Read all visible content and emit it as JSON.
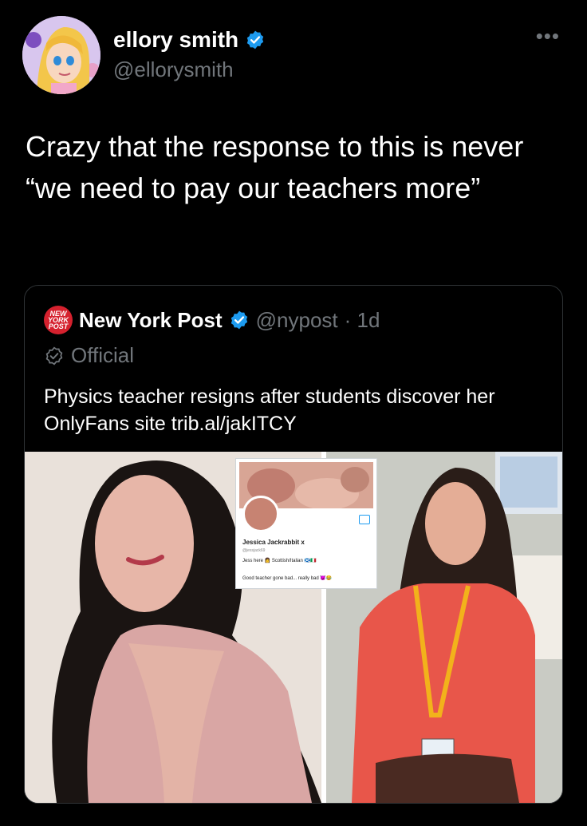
{
  "author": {
    "name": "ellory smith",
    "handle": "@ellorysmith"
  },
  "tweet": {
    "text": "Crazy that the response to this is never “we need to pay our teachers more”"
  },
  "quote": {
    "name": "New York Post",
    "handle": "@nypost",
    "time": "· 1d",
    "logo_text": "NEW YORK POST",
    "badge": "Official",
    "text": "Physics teacher resigns after students discover her OnlyFans site trib.al/jakITCY",
    "inset": {
      "name": "Jessica Jackrabbit x",
      "handle": "@jessjack69",
      "bio": "Jess here 👩 Scottish/Italian 🏴󠁧󠁢󠁳󠁣󠁴󠁿🇮🇹",
      "bio2": "Good teacher gone bad... really bad 😈😂"
    }
  },
  "colors": {
    "background": "#000000",
    "verified": "#1d9bf0",
    "muted": "#71767b",
    "nypost_red": "#d5212e"
  }
}
